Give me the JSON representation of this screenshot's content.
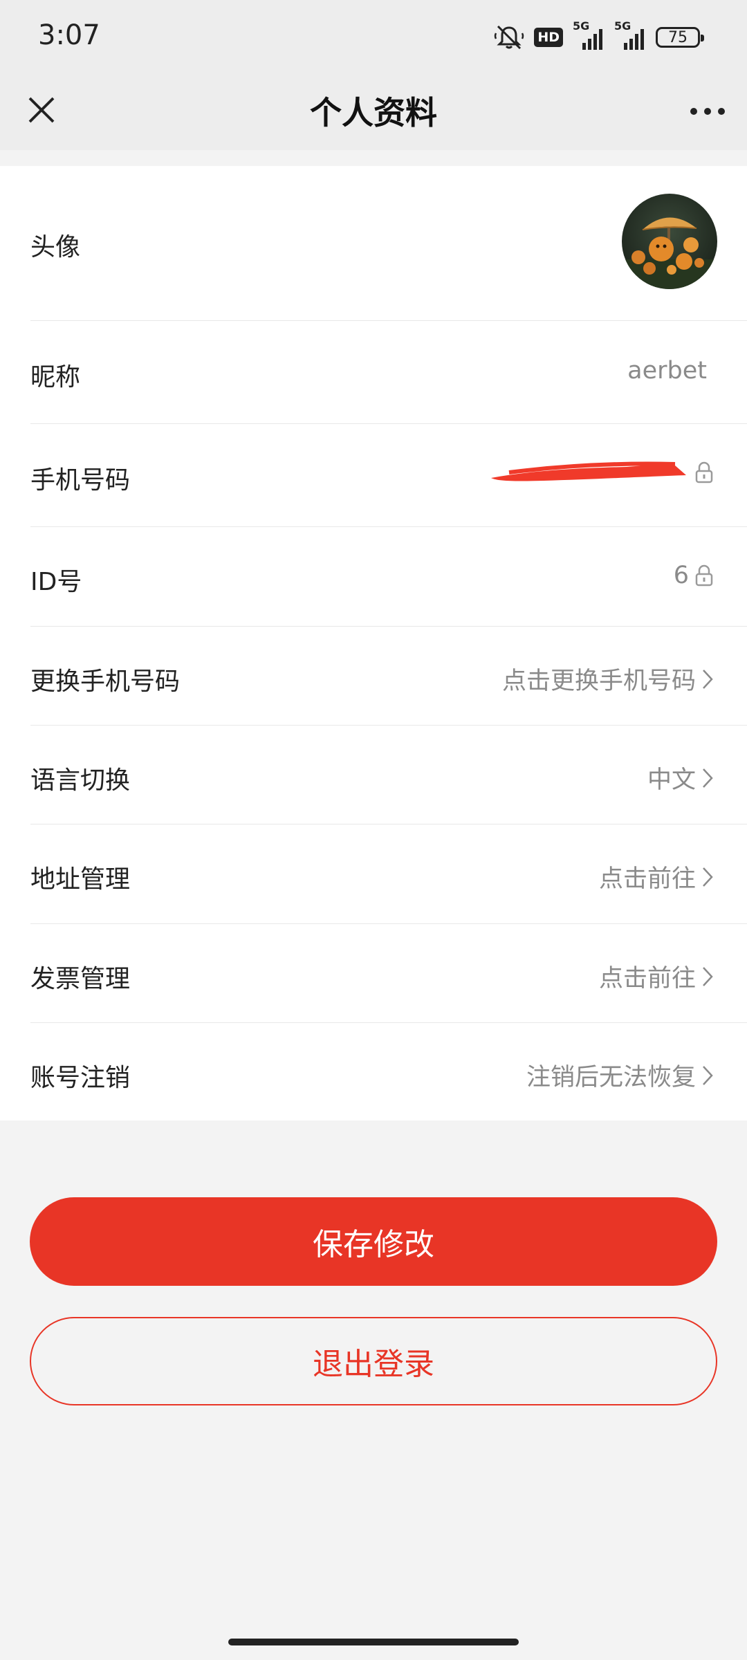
{
  "status_bar": {
    "time": "3:07",
    "hd_label": "HD",
    "network_1": "5G",
    "network_2": "5G",
    "battery": "75"
  },
  "nav": {
    "title": "个人资料"
  },
  "rows": {
    "avatar": {
      "label": "头像"
    },
    "nickname": {
      "label": "昵称",
      "value": "aerbet"
    },
    "phone": {
      "label": "手机号码",
      "value": ""
    },
    "id": {
      "label": "ID号",
      "value": "6"
    },
    "change_phone": {
      "label": "更换手机号码",
      "value": "点击更换手机号码"
    },
    "language": {
      "label": "语言切换",
      "value": "中文"
    },
    "address": {
      "label": "地址管理",
      "value": "点击前往"
    },
    "invoice": {
      "label": "发票管理",
      "value": "点击前往"
    },
    "deactivate": {
      "label": "账号注销",
      "value": "注销后无法恢复"
    }
  },
  "buttons": {
    "save": "保存修改",
    "logout": "退出登录"
  },
  "colors": {
    "accent": "#e83526",
    "background": "#f3f3f3",
    "card": "#ffffff",
    "secondary_text": "#8a8a8a"
  },
  "icons": [
    "mute-icon",
    "hd-icon",
    "signal-icon",
    "battery-icon",
    "close-icon",
    "more-icon",
    "lock-icon",
    "chevron-right-icon"
  ]
}
